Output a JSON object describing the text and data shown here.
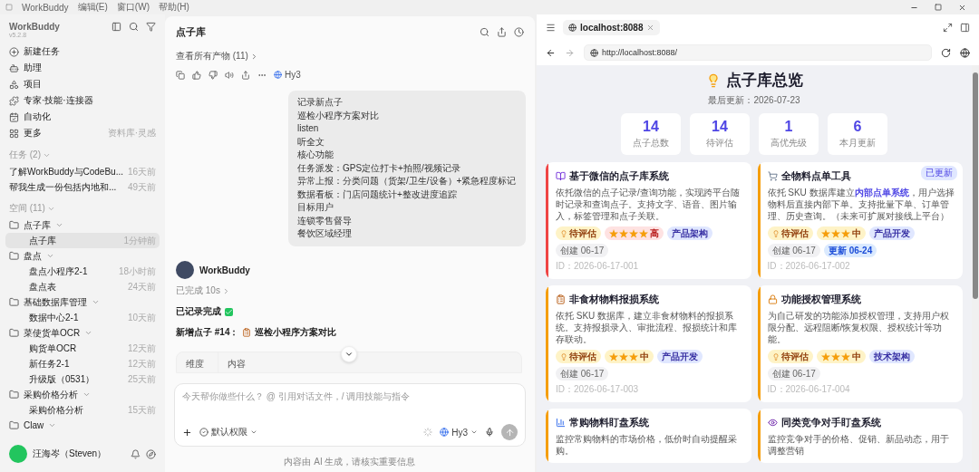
{
  "menubar": {
    "app": "WorkBuddy",
    "menus": [
      "编辑(E)",
      "窗口(W)",
      "帮助(H)"
    ]
  },
  "sidebar": {
    "app_name": "WorkBuddy",
    "version": "v5.2.8",
    "nav": [
      {
        "label": "新建任务"
      },
      {
        "label": "助理"
      },
      {
        "label": "项目"
      },
      {
        "label": "专家·技能·连接器"
      },
      {
        "label": "自动化"
      },
      {
        "label": "更多",
        "hint": "资料库·灵感"
      }
    ],
    "tasks_header": "任务 (2)",
    "tasks": [
      {
        "title": "了解WorkBuddy与CodeBu...",
        "time": "16天前"
      },
      {
        "title": "帮我生成一份包括内地和...",
        "time": "49天前"
      }
    ],
    "spaces_header": "空间 (11)",
    "spaces": [
      {
        "name": "点子库",
        "expanded": true,
        "children": [
          {
            "title": "点子库",
            "time": "1分钟前",
            "selected": true
          }
        ]
      },
      {
        "name": "盘点",
        "expanded": true,
        "children": [
          {
            "title": "盘点小程序2-1",
            "time": "18小时前",
            "selected": false
          },
          {
            "title": "盘点表",
            "time": "24天前",
            "selected": false
          }
        ]
      },
      {
        "name": "基础数据库管理",
        "expanded": true,
        "children": [
          {
            "title": "数据中心2-1",
            "time": "10天前",
            "selected": false
          }
        ]
      },
      {
        "name": "菜使货单OCR",
        "expanded": true,
        "children": [
          {
            "title": "购货单OCR",
            "time": "12天前",
            "selected": false
          },
          {
            "title": "新任务2-1",
            "time": "12天前",
            "selected": false
          },
          {
            "title": "升级版（0531）",
            "time": "25天前",
            "selected": false
          }
        ]
      },
      {
        "name": "采购价格分析",
        "expanded": true,
        "children": [
          {
            "title": "采购价格分析",
            "time": "15天前",
            "selected": false
          }
        ]
      },
      {
        "name": "Claw",
        "expanded": true
      }
    ],
    "user": {
      "name": "汪海岑（Steven）"
    }
  },
  "chat": {
    "title": "点子库",
    "artifacts_link": "查看所有产物 (11)",
    "model": "Hy3",
    "user_message": [
      "记录新点子",
      "巡检小程序方案对比",
      "listen",
      "听全文",
      "核心功能",
      "任务派发：GPS定位打卡+拍照/视频记录",
      "异常上报：分类问题（货架/卫生/设备）+紧急程度标记",
      "数据看板：门店问题统计+整改进度追踪",
      "目标用户",
      "连锁零售督导",
      "餐饮区域经理"
    ],
    "reply": {
      "sender": "WorkBuddy",
      "status": "已完成 10s",
      "done_text": "已记录完成",
      "new_label": "新增点子 #14：",
      "new_title": "巡检小程序方案对比",
      "table_columns": [
        "维度",
        "内容"
      ]
    },
    "input": {
      "placeholder": "今天帮你做些什么？ @ 引用对话文件，/ 调用技能与指令",
      "permission": "默认权限",
      "model": "Hy3"
    },
    "footer": "内容由 AI 生成，请核实重要信息"
  },
  "browser": {
    "tab": "localhost:8088",
    "url": "http://localhost:8088/",
    "page": {
      "title": "点子库总览",
      "updated": "最后更新：2026-07-23",
      "stats": [
        {
          "value": "14",
          "label": "点子总数"
        },
        {
          "value": "14",
          "label": "待评估"
        },
        {
          "value": "1",
          "label": "高优先级"
        },
        {
          "value": "6",
          "label": "本月更新"
        }
      ],
      "cards": [
        {
          "title": "基于微信的点子库系统",
          "color": "#ef4444",
          "description": "依托微信的点子记录/查询功能，实现跨平台随时记录和查询点子。支持文字、语音、图片输入，标签管理和点子关联。",
          "tags": [
            {
              "kind": "status",
              "text": "待评估"
            },
            {
              "kind": "priority",
              "stars": 4,
              "text": "高"
            },
            {
              "kind": "category",
              "text": "产品架构"
            },
            {
              "kind": "created",
              "text": "创建 06-17"
            }
          ],
          "id": "ID：2026-06-17-001"
        },
        {
          "title": "全物料点单工具",
          "color": "#f59e0b",
          "badge": "已更新",
          "description": "依托 SKU 数据库建立**内部点单系统**，用户选择物料后直接内部下单。支持批量下单、订单管理、历史查询。（未来可扩展对接线上平台）",
          "tags": [
            {
              "kind": "status",
              "text": "待评估"
            },
            {
              "kind": "priority",
              "stars": 3,
              "text": "中"
            },
            {
              "kind": "category",
              "text": "产品开发"
            },
            {
              "kind": "created",
              "text": "创建 06-17"
            },
            {
              "kind": "updated",
              "text": "更新 06-24"
            }
          ],
          "id": "ID：2026-06-17-002"
        },
        {
          "title": "非食材物料报损系统",
          "color": "#f59e0b",
          "description": "依托 SKU 数据库，建立非食材物料的报损系统。支持报损录入、审批流程、报损统计和库存联动。",
          "tags": [
            {
              "kind": "status",
              "text": "待评估"
            },
            {
              "kind": "priority",
              "stars": 3,
              "text": "中"
            },
            {
              "kind": "category",
              "text": "产品开发"
            },
            {
              "kind": "created",
              "text": "创建 06-17"
            }
          ],
          "id": "ID：2026-06-17-003"
        },
        {
          "title": "功能授权管理系统",
          "color": "#f59e0b",
          "description": "为自己研发的功能添加授权管理，支持用户权限分配、远程阻断/恢复权限、授权统计等功能。",
          "tags": [
            {
              "kind": "status",
              "text": "待评估"
            },
            {
              "kind": "priority",
              "stars": 3,
              "text": "中"
            },
            {
              "kind": "category",
              "text": "技术架构"
            },
            {
              "kind": "created",
              "text": "创建 06-17"
            }
          ],
          "id": "ID：2026-06-17-004"
        },
        {
          "title": "常购物料盯盘系统",
          "color": "#f59e0b",
          "description": "监控常购物料的市场价格，低价时自动提醒采购。"
        },
        {
          "title": "同类竞争对手盯盘系统",
          "color": "#f59e0b",
          "description": "监控竞争对手的价格、促销、新品动态，用于调整营销"
        }
      ]
    }
  }
}
